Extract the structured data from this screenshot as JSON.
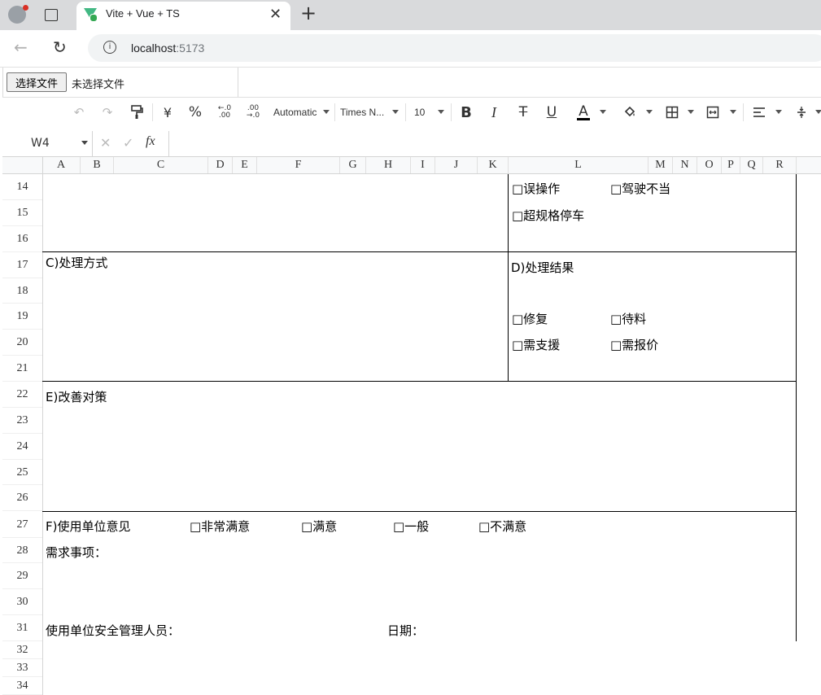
{
  "browser": {
    "tab_title": "Vite + Vue + TS",
    "url_host": "localhost",
    "url_port": ":5173"
  },
  "file_input": {
    "button_label": "选择文件",
    "status": "未选择文件"
  },
  "toolbar": {
    "currency": "¥",
    "percent": "%",
    "number_format": "Automatic",
    "font_name": "Times N...",
    "font_size": "10",
    "text_color": "#000000"
  },
  "formula_bar": {
    "cell_ref": "W4",
    "fx": "fx",
    "value": ""
  },
  "columns": [
    "A",
    "B",
    "C",
    "D",
    "E",
    "F",
    "G",
    "H",
    "I",
    "J",
    "K",
    "L",
    "M",
    "N",
    "O",
    "P",
    "Q",
    "R"
  ],
  "rows": [
    "14",
    "15",
    "16",
    "17",
    "18",
    "19",
    "20",
    "21",
    "22",
    "23",
    "24",
    "25",
    "26",
    "27",
    "28",
    "29",
    "30",
    "31",
    "32",
    "33",
    "34"
  ],
  "cells": {
    "cause_options": [
      "□误操作",
      "□驾驶不当",
      "□超规格停车"
    ],
    "section_c": "C)处理方式",
    "section_d": "D)处理结果",
    "result_options": [
      "□修复",
      "□待料",
      "□需支援",
      "□需报价"
    ],
    "section_e": "E)改善对策",
    "section_f": "F)使用单位意见",
    "satisfaction_options": [
      "□非常满意",
      "□满意",
      "□一般",
      "□不满意"
    ],
    "needs": "需求事项：",
    "safety_manager": "使用单位安全管理人员：",
    "date": "日期："
  }
}
